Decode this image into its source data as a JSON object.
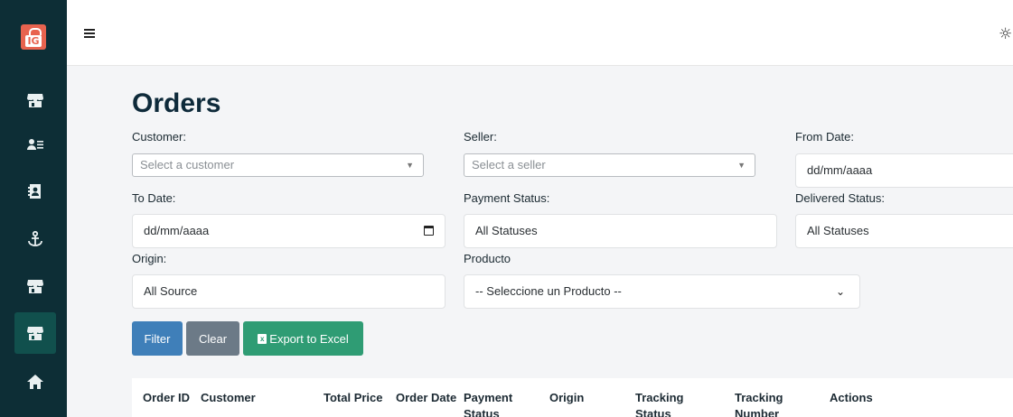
{
  "sidebar": {
    "logo_text": "IG",
    "items": [
      {
        "icon": "store-icon",
        "active": false
      },
      {
        "icon": "contacts-icon",
        "active": false
      },
      {
        "icon": "address-book-icon",
        "active": false
      },
      {
        "icon": "anchor-icon",
        "active": false
      },
      {
        "icon": "store-icon",
        "active": false
      },
      {
        "icon": "store-icon",
        "active": true
      },
      {
        "icon": "home-icon",
        "active": false
      }
    ]
  },
  "topbar": {
    "theme_icon": "sun-icon"
  },
  "page": {
    "title": "Orders"
  },
  "filters": {
    "customer_label": "Customer:",
    "customer_placeholder": "Select a customer",
    "seller_label": "Seller:",
    "seller_placeholder": "Select a seller",
    "from_date_label": "From Date:",
    "from_date_value": "dd/mm/aaaa",
    "to_date_label": "To Date:",
    "to_date_value": "dd/mm/aaaa",
    "payment_status_label": "Payment Status:",
    "payment_status_value": "All Statuses",
    "delivered_status_label": "Delivered Status:",
    "delivered_status_value": "All Statuses",
    "origin_label": "Origin:",
    "origin_value": "All Source",
    "producto_label": "Producto",
    "producto_value": "-- Seleccione un Producto --"
  },
  "actions": {
    "filter_label": "Filter",
    "clear_label": "Clear",
    "export_label": "Export to Excel"
  },
  "table": {
    "columns": [
      "Order ID",
      "Customer",
      "Total Price",
      "Order Date",
      "Payment Status",
      "Origin",
      "Tracking Status",
      "Tracking Number",
      "Actions"
    ]
  },
  "colors": {
    "sidebar_bg": "#0d2e36",
    "active_item": "#11504d",
    "filter_btn": "#3f7fb9",
    "clear_btn": "#6c7a87",
    "export_btn": "#2f9c74"
  }
}
